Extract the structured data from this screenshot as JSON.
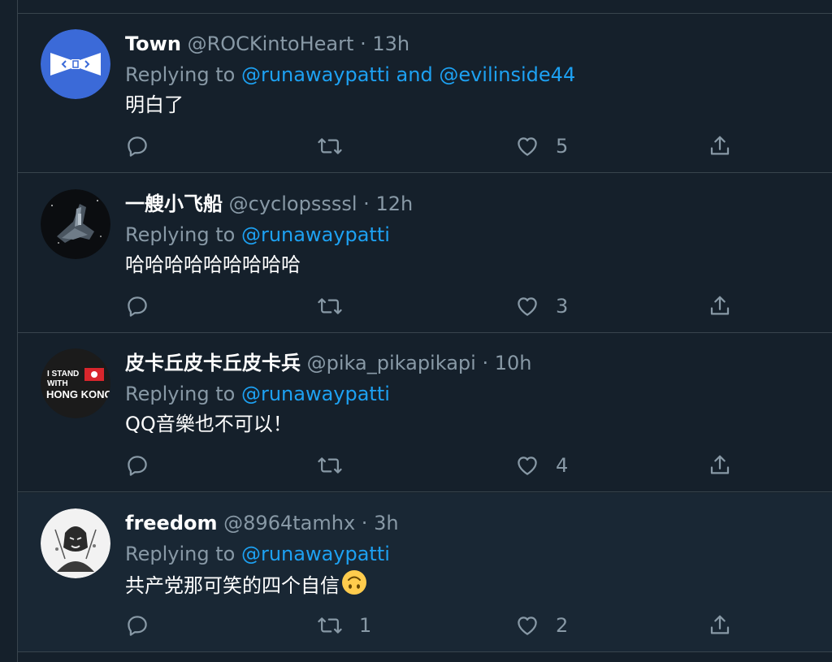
{
  "tweets": [
    {
      "name": "Town",
      "handle": "@ROCKintoHeart",
      "separator": "·",
      "time": "13h",
      "replying_prefix": "Replying to",
      "mentions": "@runawaypatti and @evilinside44",
      "text": "明白了",
      "replies": "",
      "retweets": "",
      "likes": "5",
      "avatar": "bowtie-avatar"
    },
    {
      "name": "一艘小飞船",
      "handle": "@cyclopssssl",
      "separator": "·",
      "time": "12h",
      "replying_prefix": "Replying to",
      "mentions": "@runawaypatti",
      "text": "哈哈哈哈哈哈哈哈哈",
      "replies": "",
      "retweets": "",
      "likes": "3",
      "avatar": "spaceship-avatar"
    },
    {
      "name": "皮卡丘皮卡丘皮卡兵",
      "handle": "@pika_pikapikapi",
      "separator": "·",
      "time": "10h",
      "replying_prefix": "Replying to",
      "mentions": "@runawaypatti",
      "text": "QQ音樂也不可以！",
      "replies": "",
      "retweets": "",
      "likes": "4",
      "avatar": "stand-with-hong-kong-avatar",
      "avatar_text": [
        "I STAND",
        "WITH",
        "HONG KONG"
      ]
    },
    {
      "name": "freedom",
      "handle": "@8964tamhx",
      "separator": "·",
      "time": "3h",
      "replying_prefix": "Replying to",
      "mentions": "@runawaypatti",
      "text": "共产党那可笑的四个自信",
      "emoji": "upside-down-face",
      "replies": "",
      "retweets": "1",
      "likes": "2",
      "avatar": "masked-figure-avatar"
    }
  ],
  "colors": {
    "background": "#15202b",
    "highlight_row": "#192734",
    "divider": "#38444d",
    "secondary_text": "#8899a6",
    "link": "#1da1f2",
    "avatar_blue": "#3b6ad8"
  }
}
